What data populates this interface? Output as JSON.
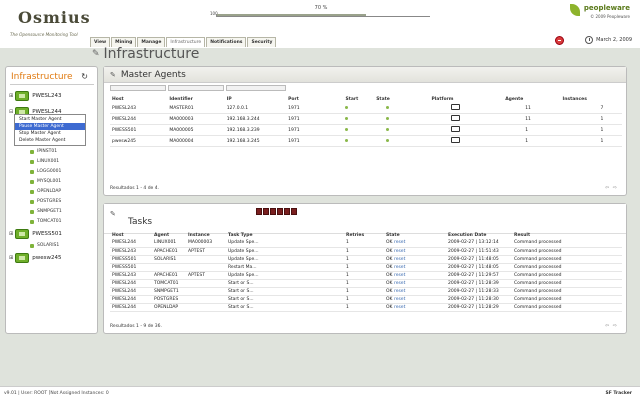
{
  "header": {
    "logo_text": "Osmius",
    "logo_tagline": "The Opensource Monitoring Tool",
    "progress_label": "100",
    "progress_percent": "70 %",
    "progress_value": 0.7,
    "brand_name": "peopleware",
    "brand_copy": "© 2009 Peopleware",
    "date": "March 2, 2009",
    "tabs": [
      {
        "label": "View",
        "active": false
      },
      {
        "label": "Mining",
        "active": false
      },
      {
        "label": "Manage",
        "active": false
      },
      {
        "label": "Infrastructure",
        "active": true
      },
      {
        "label": "Notifications",
        "active": false
      },
      {
        "label": "Security",
        "active": false
      }
    ]
  },
  "page_title": "Infrastructure",
  "sidebar": {
    "title": "Infrastructure",
    "hosts": [
      {
        "name": "PWESL243",
        "expanded": false
      },
      {
        "name": "PWESL244",
        "expanded": true
      },
      {
        "name": "PWESS501",
        "expanded": false
      },
      {
        "name": "pwesw245",
        "expanded": false
      }
    ],
    "agents_under_244": [
      "IPINST01",
      "LINUX001",
      "LOGG0001",
      "MYSQL001",
      "OPENLDAP",
      "POSTGRES",
      "SNMPGET1",
      "TOMCAT01"
    ],
    "agents_under_s501": [
      "SOLARIS1"
    ],
    "context_menu": [
      {
        "label": "Start Master Agent",
        "highlighted": false
      },
      {
        "label": "Pause Master Agent",
        "highlighted": true
      },
      {
        "label": "Stop Master Agent",
        "highlighted": false
      },
      {
        "label": "Delete Master Agent",
        "highlighted": false
      }
    ]
  },
  "master_agents": {
    "title": "Master Agents",
    "columns": [
      "Host",
      "Identifier",
      "IP",
      "Port",
      "Start",
      "State",
      "Platform",
      "Agente",
      "Instances"
    ],
    "rows": [
      {
        "host": "PWESL243",
        "id": "MASTER01",
        "ip": "127.0.0.1",
        "port": "1971",
        "agente": "11",
        "instances": "7"
      },
      {
        "host": "PWESL244",
        "id": "MA000003",
        "ip": "192.168.3.244",
        "port": "1971",
        "agente": "11",
        "instances": "1"
      },
      {
        "host": "PWESS501",
        "id": "MA000005",
        "ip": "192.168.3.239",
        "port": "1971",
        "agente": "1",
        "instances": "1"
      },
      {
        "host": "pwesw245",
        "id": "MA000004",
        "ip": "192.168.3.245",
        "port": "1971",
        "agente": "1",
        "instances": "1"
      }
    ],
    "footer": "Resultados 1 - 4 de 4."
  },
  "tasks": {
    "title": "Tasks",
    "columns": [
      "Host",
      "Agent",
      "Instance",
      "Task Type",
      "Retries",
      "State",
      "Execution Date",
      "Result"
    ],
    "rows": [
      {
        "host": "PWESL244",
        "agent": "LINUX001",
        "instance": "MA000003",
        "type": "Update Spe...",
        "retries": "1",
        "state": "OK",
        "reset": "reset",
        "date": "2009-02-27 | 13:12:14",
        "result": "Command processed"
      },
      {
        "host": "PWESL243",
        "agent": "APACHE01",
        "instance": "APTEST",
        "type": "Update Spe...",
        "retries": "1",
        "state": "OK",
        "reset": "reset",
        "date": "2009-02-27 | 11:51:43",
        "result": "Command processed"
      },
      {
        "host": "PWESS501",
        "agent": "SOLARIS1",
        "instance": "",
        "type": "Update Spe...",
        "retries": "1",
        "state": "OK",
        "reset": "reset",
        "date": "2009-02-27 | 11:48:05",
        "result": "Command processed"
      },
      {
        "host": "PWESS501",
        "agent": "",
        "instance": "",
        "type": "Restart Ma...",
        "retries": "1",
        "state": "OK",
        "reset": "reset",
        "date": "2009-02-27 | 11:48:05",
        "result": "Command processed"
      },
      {
        "host": "PWESL243",
        "agent": "APACHE01",
        "instance": "APTEST",
        "type": "Update Spe...",
        "retries": "1",
        "state": "OK",
        "reset": "reset",
        "date": "2009-02-27 | 11:29:57",
        "result": "Command processed"
      },
      {
        "host": "PWESL244",
        "agent": "TOMCAT01",
        "instance": "",
        "type": "Start or S...",
        "retries": "1",
        "state": "OK",
        "reset": "reset",
        "date": "2009-02-27 | 11:28:39",
        "result": "Command processed"
      },
      {
        "host": "PWESL244",
        "agent": "SNMPGET1",
        "instance": "",
        "type": "Start or S...",
        "retries": "1",
        "state": "OK",
        "reset": "reset",
        "date": "2009-02-27 | 11:28:33",
        "result": "Command processed"
      },
      {
        "host": "PWESL244",
        "agent": "POSTGRES",
        "instance": "",
        "type": "Start or S...",
        "retries": "1",
        "state": "OK",
        "reset": "reset",
        "date": "2009-02-27 | 11:28:30",
        "result": "Command processed"
      },
      {
        "host": "PWESL244",
        "agent": "OPENLDAP",
        "instance": "",
        "type": "Start or S...",
        "retries": "1",
        "state": "OK",
        "reset": "reset",
        "date": "2009-02-27 | 11:28:29",
        "result": "Command processed"
      }
    ],
    "footer": "Resultados 1 - 9 de 36."
  },
  "status_bar": {
    "left": "v9.01 | User: ROOT [Not Assigned Instances: 0",
    "right": "SF Tracker"
  },
  "colors": {
    "accent": "#e07a10",
    "host_green": "#6fae2a",
    "alert_red": "#d83a3a",
    "link_blue": "#3a6ab0"
  }
}
